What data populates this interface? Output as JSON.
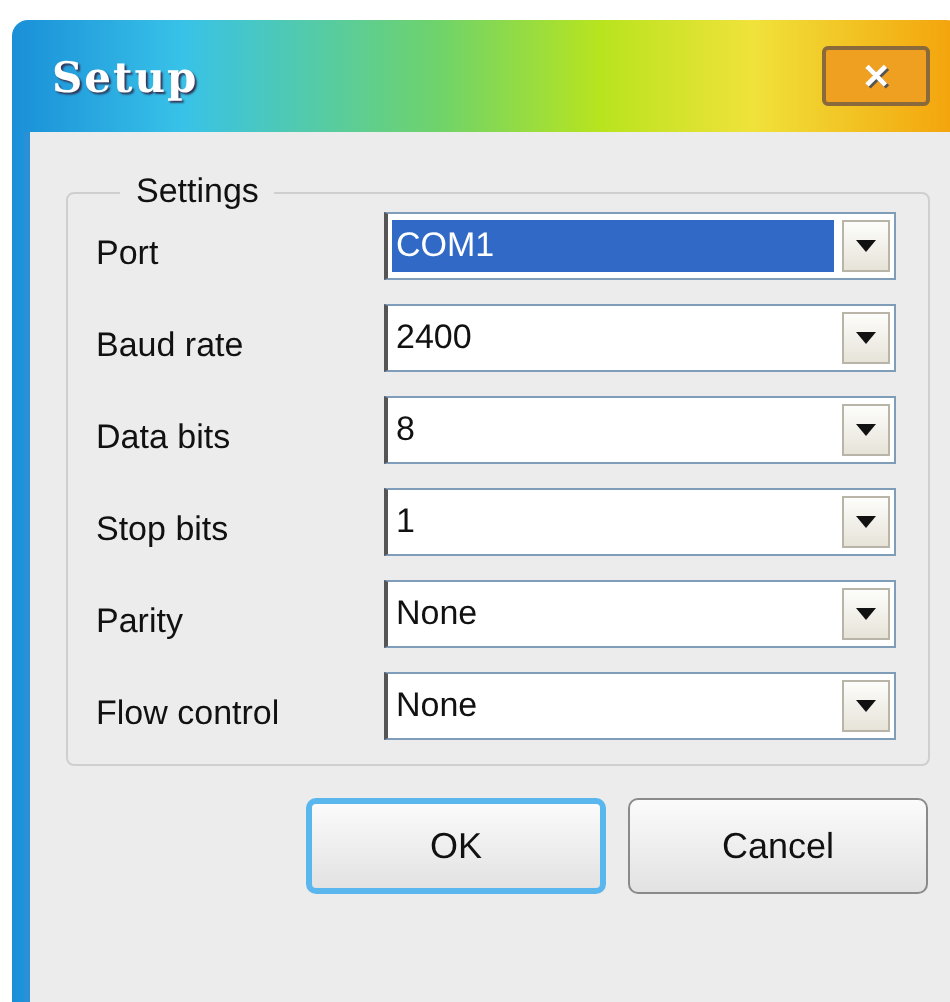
{
  "window": {
    "title": "Setup",
    "close": "✕"
  },
  "group": {
    "title": "Settings",
    "fields": [
      {
        "label": "Port",
        "value": "COM1",
        "selected": true
      },
      {
        "label": "Baud rate",
        "value": "2400",
        "selected": false
      },
      {
        "label": "Data bits",
        "value": "8",
        "selected": false
      },
      {
        "label": "Stop bits",
        "value": "1",
        "selected": false
      },
      {
        "label": "Parity",
        "value": "None",
        "selected": false
      },
      {
        "label": "Flow control",
        "value": "None",
        "selected": false
      }
    ]
  },
  "buttons": [
    {
      "label": "OK",
      "default": true
    },
    {
      "label": "Cancel",
      "default": false
    }
  ]
}
